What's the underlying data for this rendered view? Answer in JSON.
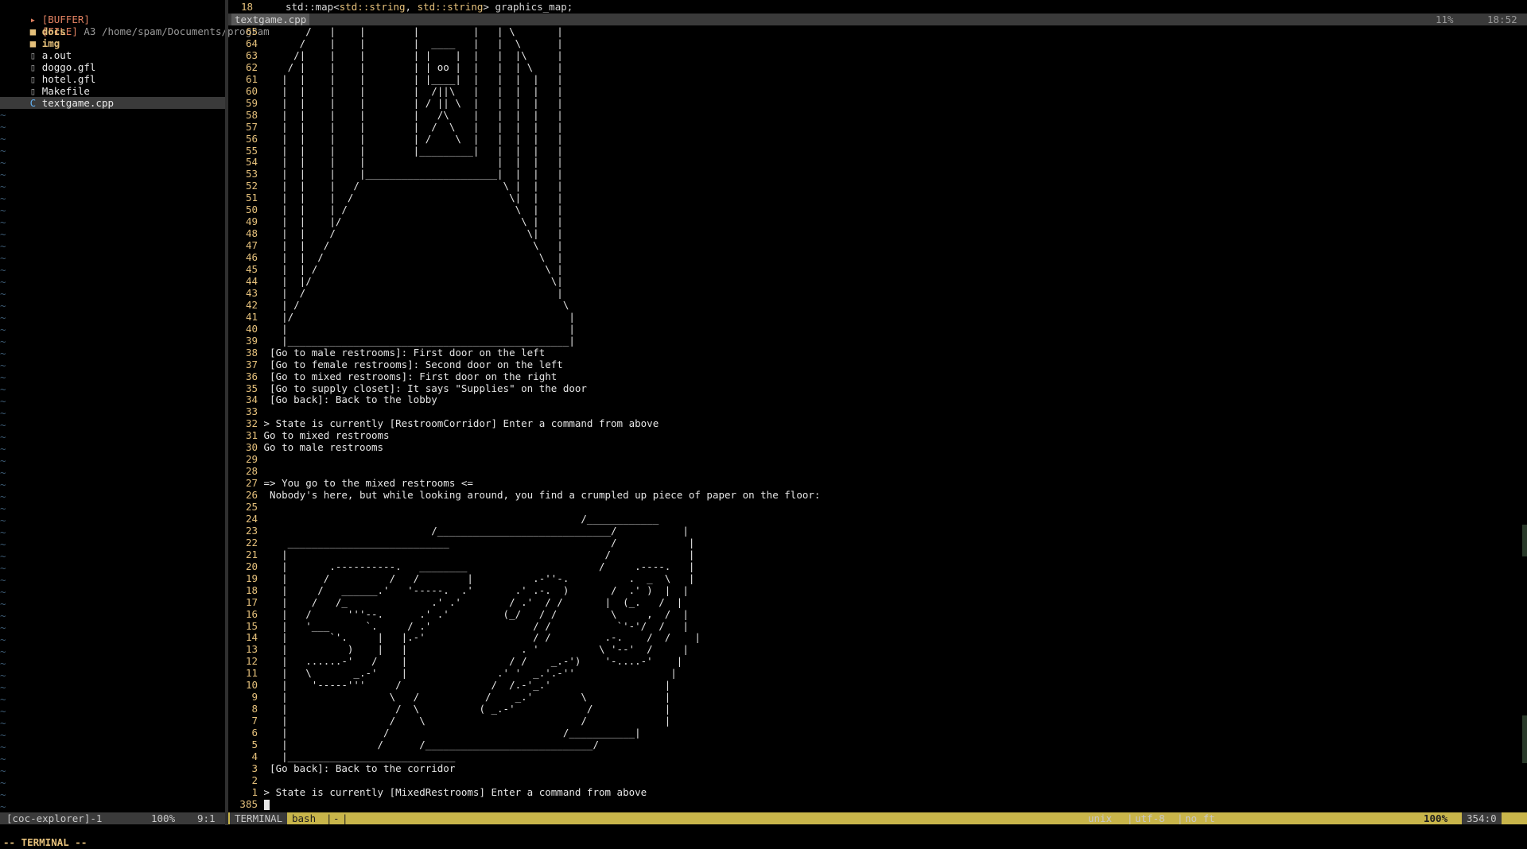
{
  "explorer": {
    "buffer_label": "[BUFFER]",
    "file_label": "[FILE]",
    "file_name": "A3",
    "file_path": "/home/spam/Documents/program",
    "items": [
      {
        "name": "docs",
        "kind": "folder"
      },
      {
        "name": "img",
        "kind": "folder"
      },
      {
        "name": "a.out",
        "kind": "file"
      },
      {
        "name": "doggo.gfl",
        "kind": "file"
      },
      {
        "name": "hotel.gfl",
        "kind": "file"
      },
      {
        "name": "Makefile",
        "kind": "file"
      },
      {
        "name": "textgame.cpp",
        "kind": "cpp",
        "selected": true
      }
    ],
    "status_name": "[coc-explorer]-1",
    "status_percent": "100%",
    "status_pos": "9:1"
  },
  "tabline": {
    "line_number": "18",
    "code_prefix": "std::map<",
    "code_type1": "std::string",
    "code_sep": ", ",
    "code_type2": "std::string",
    "code_suffix": "> graphics_map;"
  },
  "winbar": {
    "tab": "textgame.cpp",
    "percent": "11%",
    "time": "18:52"
  },
  "terminal_lines": [
    {
      "n": "65",
      "t": "       /   |    |        |         |   | \\       |"
    },
    {
      "n": "64",
      "t": "      /    |    |        |  ____   |   |  \\      |"
    },
    {
      "n": "63",
      "t": "     /|    |    |        | |    |  |   |  |\\     |"
    },
    {
      "n": "62",
      "t": "    / |    |    |        | | oo |  |   |  | \\    |"
    },
    {
      "n": "61",
      "t": "   |  |    |    |        | |____|  |   |  |  |   |"
    },
    {
      "n": "60",
      "t": "   |  |    |    |        |  /||\\   |   |  |  |   |"
    },
    {
      "n": "59",
      "t": "   |  |    |    |        | / || \\  |   |  |  |   |"
    },
    {
      "n": "58",
      "t": "   |  |    |    |        |   /\\    |   |  |  |   |"
    },
    {
      "n": "57",
      "t": "   |  |    |    |        |  /  \\   |   |  |  |   |"
    },
    {
      "n": "56",
      "t": "   |  |    |    |        | /    \\  |   |  |  |   |"
    },
    {
      "n": "55",
      "t": "   |  |    |    |        |_________|   |  |  |   |"
    },
    {
      "n": "54",
      "t": "   |  |    |    |                      |  |  |   |"
    },
    {
      "n": "53",
      "t": "   |  |    |    |______________________|  |  |   |"
    },
    {
      "n": "52",
      "t": "   |  |    |   /                        \\ |  |   |"
    },
    {
      "n": "51",
      "t": "   |  |    |  /                          \\|  |   |"
    },
    {
      "n": "50",
      "t": "   |  |    | /                            \\  |   |"
    },
    {
      "n": "49",
      "t": "   |  |    |/                              \\ |   |"
    },
    {
      "n": "48",
      "t": "   |  |    /                                \\|   |"
    },
    {
      "n": "47",
      "t": "   |  |   /                                  \\   |"
    },
    {
      "n": "46",
      "t": "   |  |  /                                    \\  |"
    },
    {
      "n": "45",
      "t": "   |  | /                                      \\ |"
    },
    {
      "n": "44",
      "t": "   |  |/                                        \\|"
    },
    {
      "n": "43",
      "t": "   |  /                                          |"
    },
    {
      "n": "42",
      "t": "   | /                                            \\"
    },
    {
      "n": "41",
      "t": "   |/                                              |"
    },
    {
      "n": "40",
      "t": "   |                                               |"
    },
    {
      "n": "39",
      "t": "   |_______________________________________________|"
    },
    {
      "n": "38",
      "t": " [Go to male restrooms]: First door on the left"
    },
    {
      "n": "37",
      "t": " [Go to female restrooms]: Second door on the left"
    },
    {
      "n": "36",
      "t": " [Go to mixed restrooms]: First door on the right"
    },
    {
      "n": "35",
      "t": " [Go to supply closet]: It says \"Supplies\" on the door"
    },
    {
      "n": "34",
      "t": " [Go back]: Back to the lobby"
    },
    {
      "n": "33",
      "t": ""
    },
    {
      "n": "32",
      "t": "> State is currently [RestroomCorridor] Enter a command from above"
    },
    {
      "n": "31",
      "t": "Go to mixed restrooms"
    },
    {
      "n": "30",
      "t": "Go to male restrooms"
    },
    {
      "n": "29",
      "t": ""
    },
    {
      "n": "28",
      "t": ""
    },
    {
      "n": "27",
      "t": "=> You go to the mixed restrooms <="
    },
    {
      "n": "26",
      "t": " Nobody's here, but while looking around, you find a crumpled up piece of paper on the floor:"
    },
    {
      "n": "25",
      "t": ""
    },
    {
      "n": "24",
      "t": "                                                     /____________"
    },
    {
      "n": "23",
      "t": "                            /_____________________________/           |"
    },
    {
      "n": "22",
      "t": "    ___________________________                           /            |"
    },
    {
      "n": "21",
      "t": "   |                                                     /             |"
    },
    {
      "n": "20",
      "t": "   |       .----------.   ________                      /     .----.   |"
    },
    {
      "n": "19",
      "t": "   |      /          /   /        |          .-''-.          .  _  \\   |"
    },
    {
      "n": "18",
      "t": "   |     /   ______.'   '-----.  .'       .' .-.  )       /  .' )  |  |"
    },
    {
      "n": "17",
      "t": "   |    /   /_              .' .'        / .'  / /       |  (_.   /  |"
    },
    {
      "n": "16",
      "t": "   |   /      '''--.      .' .'         (_/   / /         \\     ,  /  |"
    },
    {
      "n": "15",
      "t": "   |   '___      `.     / .'                 / /           `'-'/  /   |"
    },
    {
      "n": "14",
      "t": "   |       `'.     |   |.-'                  / /         .-.    /  /    |"
    },
    {
      "n": "13",
      "t": "   |          )    |   |                   . '          \\ '--'  /     |"
    },
    {
      "n": "12",
      "t": "   |   ......-'   /    |                 / /    _.-')    '-....-'    |"
    },
    {
      "n": "11",
      "t": "   |   \\       _.-'    |               .' '  _.'.-''                |"
    },
    {
      "n": "10",
      "t": "   |    '-----'''     /               /  /.-'_.'                   |"
    },
    {
      "n": "9",
      "t": "   |                 \\   /           /    _.'        \\             |"
    },
    {
      "n": "8",
      "t": "   |                  /  \\          ( _.-'            /            |"
    },
    {
      "n": "7",
      "t": "   |                 /    \\                          /             |"
    },
    {
      "n": "6",
      "t": "   |                /                             /___________|"
    },
    {
      "n": "5",
      "t": "   |               /      /____________________________/"
    },
    {
      "n": "4",
      "t": "   |____________________________"
    },
    {
      "n": "3",
      "t": " [Go back]: Back to the corridor"
    },
    {
      "n": "2",
      "t": ""
    },
    {
      "n": "1",
      "t": "> State is currently [MixedRestrooms] Enter a command from above"
    },
    {
      "n": "385",
      "t": "",
      "cursor": true
    }
  ],
  "status": {
    "mode": "TERMINAL",
    "shell": "bash",
    "dash": "-",
    "fileformat": "unix",
    "encoding": "utf-8",
    "filetype": "no ft",
    "percent": "100%",
    "position": "354:0"
  },
  "cmdline": "-- TERMINAL --"
}
